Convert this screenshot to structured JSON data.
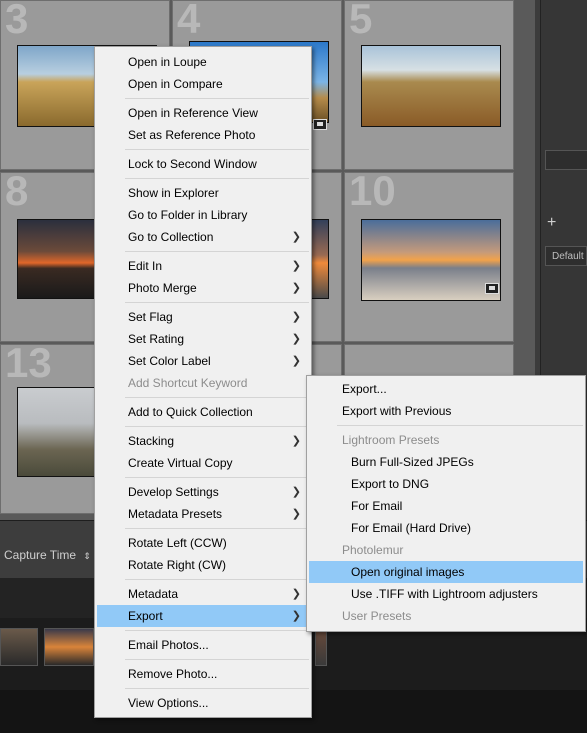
{
  "grid": {
    "cell_numbers": [
      "3",
      "4",
      "5",
      "8",
      "10",
      "13"
    ]
  },
  "right_panel": {
    "button_label": "Default",
    "plus_icon": "plus-icon"
  },
  "toolbar": {
    "sort_label": "Capture Time",
    "sort_icon": "sort-arrows-icon"
  },
  "context_menu": {
    "items": [
      {
        "label": "Open in Loupe"
      },
      {
        "label": "Open in Compare"
      },
      {
        "label": "Open in Reference View"
      },
      {
        "label": "Set as Reference Photo"
      },
      {
        "label": "Lock to Second Window"
      },
      {
        "label": "Show in Explorer"
      },
      {
        "label": "Go to Folder in Library"
      },
      {
        "label": "Go to Collection"
      },
      {
        "label": "Edit In"
      },
      {
        "label": "Photo Merge"
      },
      {
        "label": "Set Flag"
      },
      {
        "label": "Set Rating"
      },
      {
        "label": "Set Color Label"
      },
      {
        "label": "Add Shortcut Keyword"
      },
      {
        "label": "Add to Quick Collection"
      },
      {
        "label": "Stacking"
      },
      {
        "label": "Create Virtual Copy"
      },
      {
        "label": "Develop Settings"
      },
      {
        "label": "Metadata Presets"
      },
      {
        "label": "Rotate Left (CCW)"
      },
      {
        "label": "Rotate Right (CW)"
      },
      {
        "label": "Metadata"
      },
      {
        "label": "Export"
      },
      {
        "label": "Email Photos..."
      },
      {
        "label": "Remove Photo..."
      },
      {
        "label": "View Options..."
      }
    ]
  },
  "export_submenu": {
    "items": [
      {
        "label": "Export..."
      },
      {
        "label": "Export with Previous"
      },
      {
        "label": "Lightroom Presets"
      },
      {
        "label": "Burn Full-Sized JPEGs"
      },
      {
        "label": "Export to DNG"
      },
      {
        "label": "For Email"
      },
      {
        "label": "For Email (Hard Drive)"
      },
      {
        "label": "Photolemur"
      },
      {
        "label": "Open original images"
      },
      {
        "label": "Use .TIFF with Lightroom adjusters"
      },
      {
        "label": "User Presets"
      }
    ]
  },
  "colors": {
    "menu_bg": "#f0f0f0",
    "highlight": "#91c9f7",
    "disabled_text": "#8c8c8c"
  }
}
